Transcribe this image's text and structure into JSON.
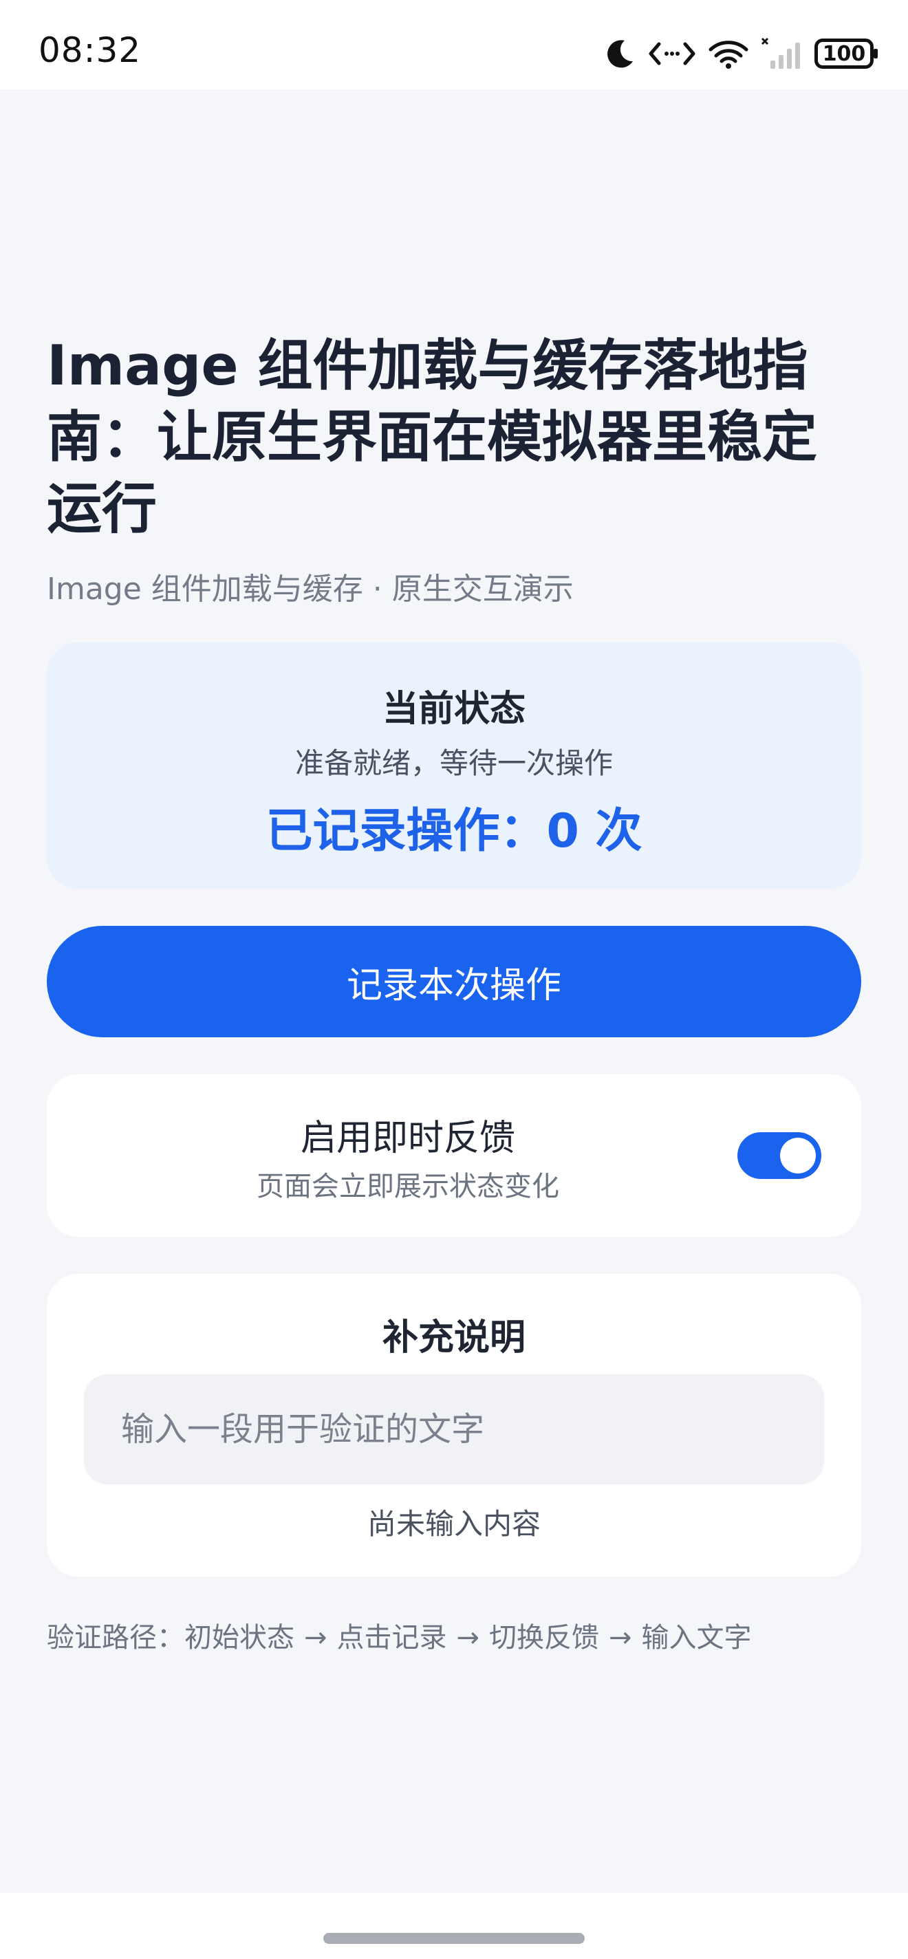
{
  "status_bar": {
    "time": "08:32",
    "battery": "100",
    "icons": [
      "moon-icon",
      "code-icon",
      "wifi-icon",
      "signal-icon",
      "battery-icon"
    ]
  },
  "page": {
    "title": "Image 组件加载与缓存落地指南：让原生界面在模拟器里稳定运行",
    "subtitle": "Image 组件加载与缓存 · 原生交互演示"
  },
  "status_card": {
    "title": "当前状态",
    "message": "准备就绪，等待一次操作",
    "count_text": "已记录操作：0 次"
  },
  "record_button": {
    "label": "记录本次操作"
  },
  "feedback_toggle": {
    "label": "启用即时反馈",
    "description": "页面会立即展示状态变化",
    "enabled": true
  },
  "note_card": {
    "title": "补充说明",
    "input_placeholder": "输入一段用于验证的文字",
    "input_value": "",
    "status": "尚未输入内容"
  },
  "verify_path": {
    "prefix": "验证路径：",
    "steps": [
      "初始状态",
      "点击记录",
      "切换反馈",
      "输入文字"
    ]
  },
  "colors": {
    "accent": "#1a63ee",
    "status_card_bg": "#eaf2fe",
    "page_bg": "#f5f6f9"
  }
}
